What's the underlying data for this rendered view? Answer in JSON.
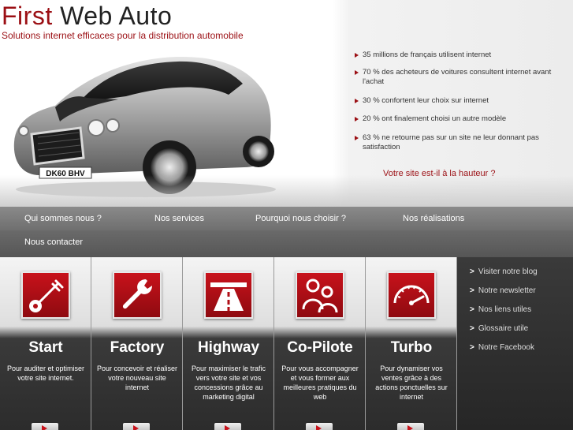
{
  "brand": {
    "logo_first": "First",
    "logo_rest": " Web Auto",
    "tagline": "Solutions internet efficaces pour la distribution automobile",
    "accent_color": "#9b0f14"
  },
  "car": {
    "plate": "DK60 BHV"
  },
  "stats": [
    "35 millions de français utilisent internet",
    "70 % des acheteurs de voitures consultent internet avant l'achat",
    "30 % confortent leur choix sur internet",
    "20 % ont finalement choisi un autre modèle",
    "63 % ne retourne pas sur un site ne leur donnant pas satisfaction"
  ],
  "cta": "Votre site est-il à la hauteur ?",
  "nav": [
    "Qui sommes nous ?",
    "Nos services",
    "Pourquoi nous choisir ?",
    "Nos réalisations",
    "Nous contacter"
  ],
  "cards": [
    {
      "title": "Start",
      "desc": "Pour auditer et optimiser votre site internet.",
      "icon": "key-icon"
    },
    {
      "title": "Factory",
      "desc": "Pour concevoir et réaliser votre nouveau site internet",
      "icon": "wrench-icon"
    },
    {
      "title": "Highway",
      "desc": "Pour maximiser le trafic vers votre site et vos concessions grâce au marketing digital",
      "icon": "highway-icon"
    },
    {
      "title": "Co-Pilote",
      "desc": "Pour vous accompagner et vous former aux meilleures pratiques du web",
      "icon": "people-icon"
    },
    {
      "title": "Turbo",
      "desc": "Pour dynamiser vos ventes grâce à des actions ponctuelles sur internet",
      "icon": "speedometer-icon"
    }
  ],
  "sidebar": {
    "bullet": ">",
    "links": [
      "Visiter notre blog",
      "Notre newsletter",
      "Nos liens utiles",
      "Glossaire utile",
      "Notre Facebook"
    ]
  }
}
